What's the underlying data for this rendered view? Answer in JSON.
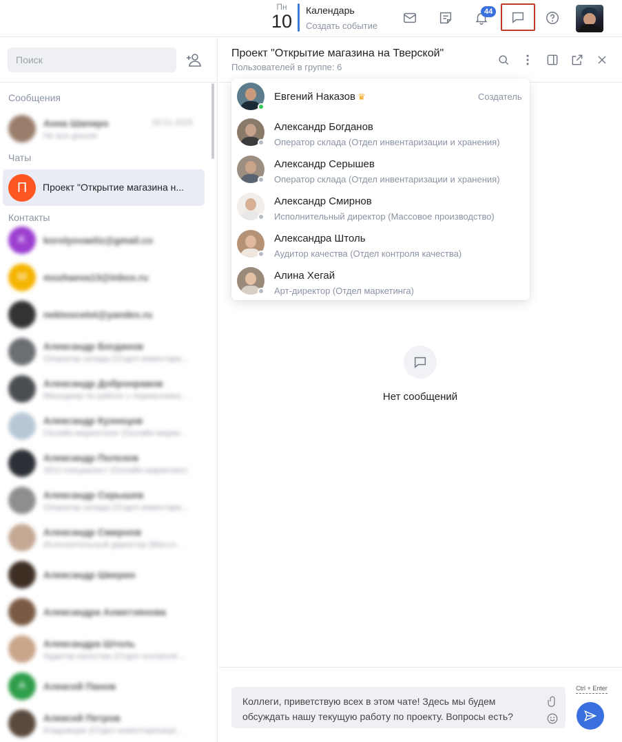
{
  "topbar": {
    "date_dow": "Пн",
    "date_day": "10",
    "calendar_title": "Календарь",
    "calendar_sub": "Создать событие",
    "notifications_count": "44"
  },
  "sidebar": {
    "search_placeholder": "Поиск",
    "messages_label": "Сообщения",
    "chats_label": "Чаты",
    "contacts_label": "Контакты",
    "messages": [
      {
        "name": "Анна Шапиро",
        "preview": "Не все дошли",
        "time": "28.01.2025"
      }
    ],
    "chats": [
      {
        "initial": "П",
        "name": "Проект \"Открытие магазина н...",
        "color": "#ff5722"
      }
    ],
    "contacts": [
      {
        "name": "korolyovaeliz@gmail.co",
        "sub": "",
        "initial": "K",
        "color": "#9c3fd0"
      },
      {
        "name": "mozhaeva13@inbox.ru",
        "sub": "",
        "initial": "M",
        "color": "#f5b400"
      },
      {
        "name": "nektoocelot@yandex.ru",
        "sub": "",
        "initial": "",
        "color": "#333333"
      },
      {
        "name": "Александр Богданов",
        "sub": "Оператор склада (Отдел инвентари...",
        "initial": "",
        "color": "#6b6e73"
      },
      {
        "name": "Александр Добронравов",
        "sub": "Менеджер по работе с перевозчика...",
        "initial": "",
        "color": "#4a4d52"
      },
      {
        "name": "Александр Кузнецов",
        "sub": "Онлайн-маркетолог (Онлайн-марке...",
        "initial": "",
        "color": "#b8c7d6"
      },
      {
        "name": "Александр Полозов",
        "sub": "SEO-специалист (Онлайн-маркетинг)",
        "initial": "",
        "color": "#2d3036"
      },
      {
        "name": "Александр Серышев",
        "sub": "Оператор склада (Отдел инвентари...",
        "initial": "",
        "color": "#8d8e90"
      },
      {
        "name": "Александр Смирнов",
        "sub": "Исполнительный директор (Массо...",
        "initial": "",
        "color": "#c5a894"
      },
      {
        "name": "Александр Шкерин",
        "sub": "",
        "initial": "",
        "color": "#3e2f25"
      },
      {
        "name": "Александра Ахметзянова",
        "sub": "",
        "initial": "",
        "color": "#7a5a45"
      },
      {
        "name": "Александра Штоль",
        "sub": "Аудитор качества (Отдел контроля ...",
        "initial": "",
        "color": "#c9a58a"
      },
      {
        "name": "Алексей Панов",
        "sub": "",
        "initial": "A",
        "color": "#2f9e4a"
      },
      {
        "name": "Алексей Петров",
        "sub": "Кладовщик (Отдел инвентаризаци...",
        "initial": "",
        "color": "#5a4a3e"
      }
    ]
  },
  "chat": {
    "title": "Проект \"Открытие магазина на Тверской\"",
    "subtitle": "Пользователей в группе: 6",
    "empty_text": "Нет сообщений",
    "composer_text": "Коллеги, приветствую всех в этом чате! Здесь мы будем обсуждать нашу текущую работу по проекту. Вопросы есть?",
    "send_hint": "Ctrl + Enter"
  },
  "members": [
    {
      "name": "Евгений Наказов",
      "role": "",
      "creator": "Создатель",
      "online": true,
      "skin": "#c99b7c",
      "cloth": "#1c2a36",
      "bg": "#5e7d8c"
    },
    {
      "name": "Александр Богданов",
      "role": "Оператор склада (Отдел инвентаризации и хранения)",
      "creator": "",
      "online": false,
      "skin": "#c7a28a",
      "cloth": "#3b3b3b",
      "bg": "#8a7a6a"
    },
    {
      "name": "Александр Серышев",
      "role": "Оператор склада (Отдел инвентаризации и хранения)",
      "creator": "",
      "online": false,
      "skin": "#caa489",
      "cloth": "#5a6470",
      "bg": "#9c8f82"
    },
    {
      "name": "Александр Смирнов",
      "role": "Исполнительный директор (Массовое производство)",
      "creator": "",
      "online": false,
      "skin": "#d7b096",
      "cloth": "#e8e8e8",
      "bg": "#f1ede8"
    },
    {
      "name": "Александра Штоль",
      "role": "Аудитор качества (Отдел контроля качества)",
      "creator": "",
      "online": false,
      "skin": "#e0b99c",
      "cloth": "#efe7dd",
      "bg": "#b59276"
    },
    {
      "name": "Алина Хегай",
      "role": "Арт-директор (Отдел маркетинга)",
      "creator": "",
      "online": false,
      "skin": "#e4c0a4",
      "cloth": "#d8d0c6",
      "bg": "#9a8a7a"
    }
  ],
  "colors": {
    "accent": "#3a6fe0",
    "highlight_border": "#c0392b",
    "crown": "#f2a71b",
    "online": "#34c759"
  }
}
